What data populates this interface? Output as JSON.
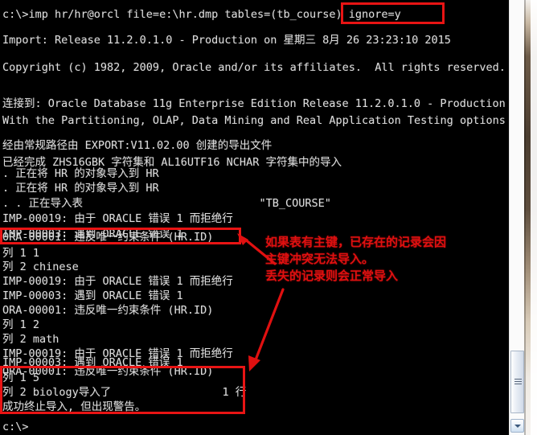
{
  "window": {
    "kind": "windows-command-prompt",
    "background_color": "#000000",
    "text_color": "#d8d8d8",
    "accent_color": "#e81414"
  },
  "console": {
    "lines": [
      "c:\\>imp hr/hr@orcl file=e:\\hr.dmp tables=(tb_course) ignore=y",
      "",
      "Import: Release 11.2.0.1.0 - Production on 星期三 8月 26 23:23:10 2015",
      "",
      "Copyright (c) 1982, 2009, Oracle and/or its affiliates.  All rights reserved.",
      "",
      "",
      "连接到: Oracle Database 11g Enterprise Edition Release 11.2.0.1.0 - Production",
      "With the Partitioning, OLAP, Data Mining and Real Application Testing options",
      "",
      "经由常规路径由 EXPORT:V11.02.00 创建的导出文件",
      "已经完成 ZHS16GBK 字符集和 AL16UTF16 NCHAR 字符集中的导入",
      ". 正在将 HR 的对象导入到 HR",
      ". 正在将 HR 的对象导入到 HR",
      ". . 正在导入表                           \"TB_COURSE\"",
      "IMP-00019: 由于 ORACLE 错误 1 而拒绝行",
      "IMP-00003: 遇到 ORACLE 错误 1",
      "ORA-00001: 违反唯一约束条件 (HR.ID)",
      "列 1 1",
      "列 2 chinese",
      "IMP-00019: 由于 ORACLE 错误 1 而拒绝行",
      "IMP-00003: 遇到 ORACLE 错误 1",
      "ORA-00001: 违反唯一约束条件 (HR.ID)",
      "列 1 2",
      "列 2 math",
      "IMP-00019: 由于 ORACLE 错误 1 而拒绝行",
      "IMP-00003: 遇到 ORACLE 错误 1",
      "ORA-00001: 违反唯一约束条件 (HR.ID)",
      "列 1 5",
      "列 2 biology导入了                 1 行",
      "成功终止导入, 但出现警告。",
      "",
      "c:\\>"
    ]
  },
  "annotations": {
    "note_lines": [
      "如果表有主键，已存在的记录会因",
      "主键冲突无法导入。",
      "丢失的记录则会正常导入"
    ],
    "highlight_ignore_param": "ignore=y",
    "highlight_constraint_error": "ORA-00001: 违反唯一约束条件 (HR.ID)",
    "highlight_result_block": "列 1 5 / 列 2 biology导入了 1 行 / 成功终止导入, 但出现警告。"
  },
  "scrollbar": {
    "orientation": "vertical",
    "down_arrow_icon": "chevron-down-icon",
    "grip_icon": "grip-lines-icon"
  }
}
